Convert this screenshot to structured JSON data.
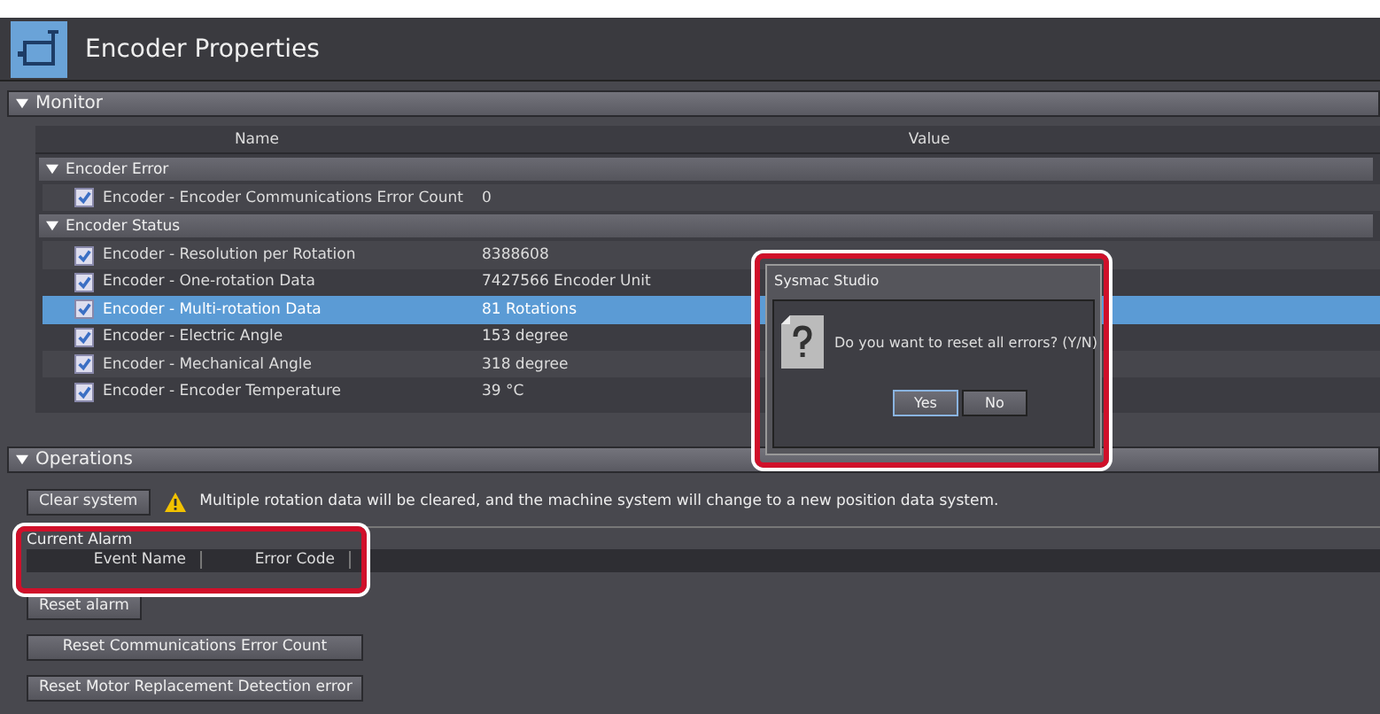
{
  "header": {
    "title": "Encoder Properties"
  },
  "monitor": {
    "title": "Monitor",
    "expanded": true,
    "columns": [
      "Name",
      "Value"
    ],
    "groups": [
      {
        "title": "Encoder Error",
        "expanded": true,
        "rows": [
          {
            "name": "Encoder - Encoder Communications Error Count",
            "value": "0",
            "checked": true,
            "selected": false
          }
        ]
      },
      {
        "title": "Encoder Status",
        "expanded": true,
        "rows": [
          {
            "name": "Encoder - Resolution per Rotation",
            "value": "8388608",
            "checked": true,
            "selected": false
          },
          {
            "name": "Encoder - One-rotation Data",
            "value": "7427566 Encoder Unit",
            "checked": true,
            "selected": false
          },
          {
            "name": "Encoder - Multi-rotation Data",
            "value": "81 Rotations",
            "checked": true,
            "selected": true
          },
          {
            "name": "Encoder - Electric Angle",
            "value": "153 degree",
            "checked": true,
            "selected": false
          },
          {
            "name": "Encoder - Mechanical Angle",
            "value": "318 degree",
            "checked": true,
            "selected": false
          },
          {
            "name": "Encoder - Encoder Temperature",
            "value": "39 °C",
            "checked": true,
            "selected": false
          }
        ]
      }
    ]
  },
  "operations": {
    "title": "Operations",
    "expanded": true,
    "clear_button": "Clear system",
    "warning": "Multiple rotation data will be cleared, and the machine system will change to a new position data system.",
    "alarm": {
      "title": "Current Alarm",
      "columns": [
        "Event Name",
        "Error Code"
      ]
    },
    "buttons": [
      "Reset alarm",
      "Reset Communications Error Count",
      "Reset Motor Replacement Detection error"
    ]
  },
  "dialog": {
    "title": "Sysmac Studio",
    "message": "Do you want to reset all errors? (Y/N)",
    "buttons": [
      {
        "label": "Yes",
        "selected": true
      },
      {
        "label": "No",
        "selected": false
      }
    ]
  }
}
